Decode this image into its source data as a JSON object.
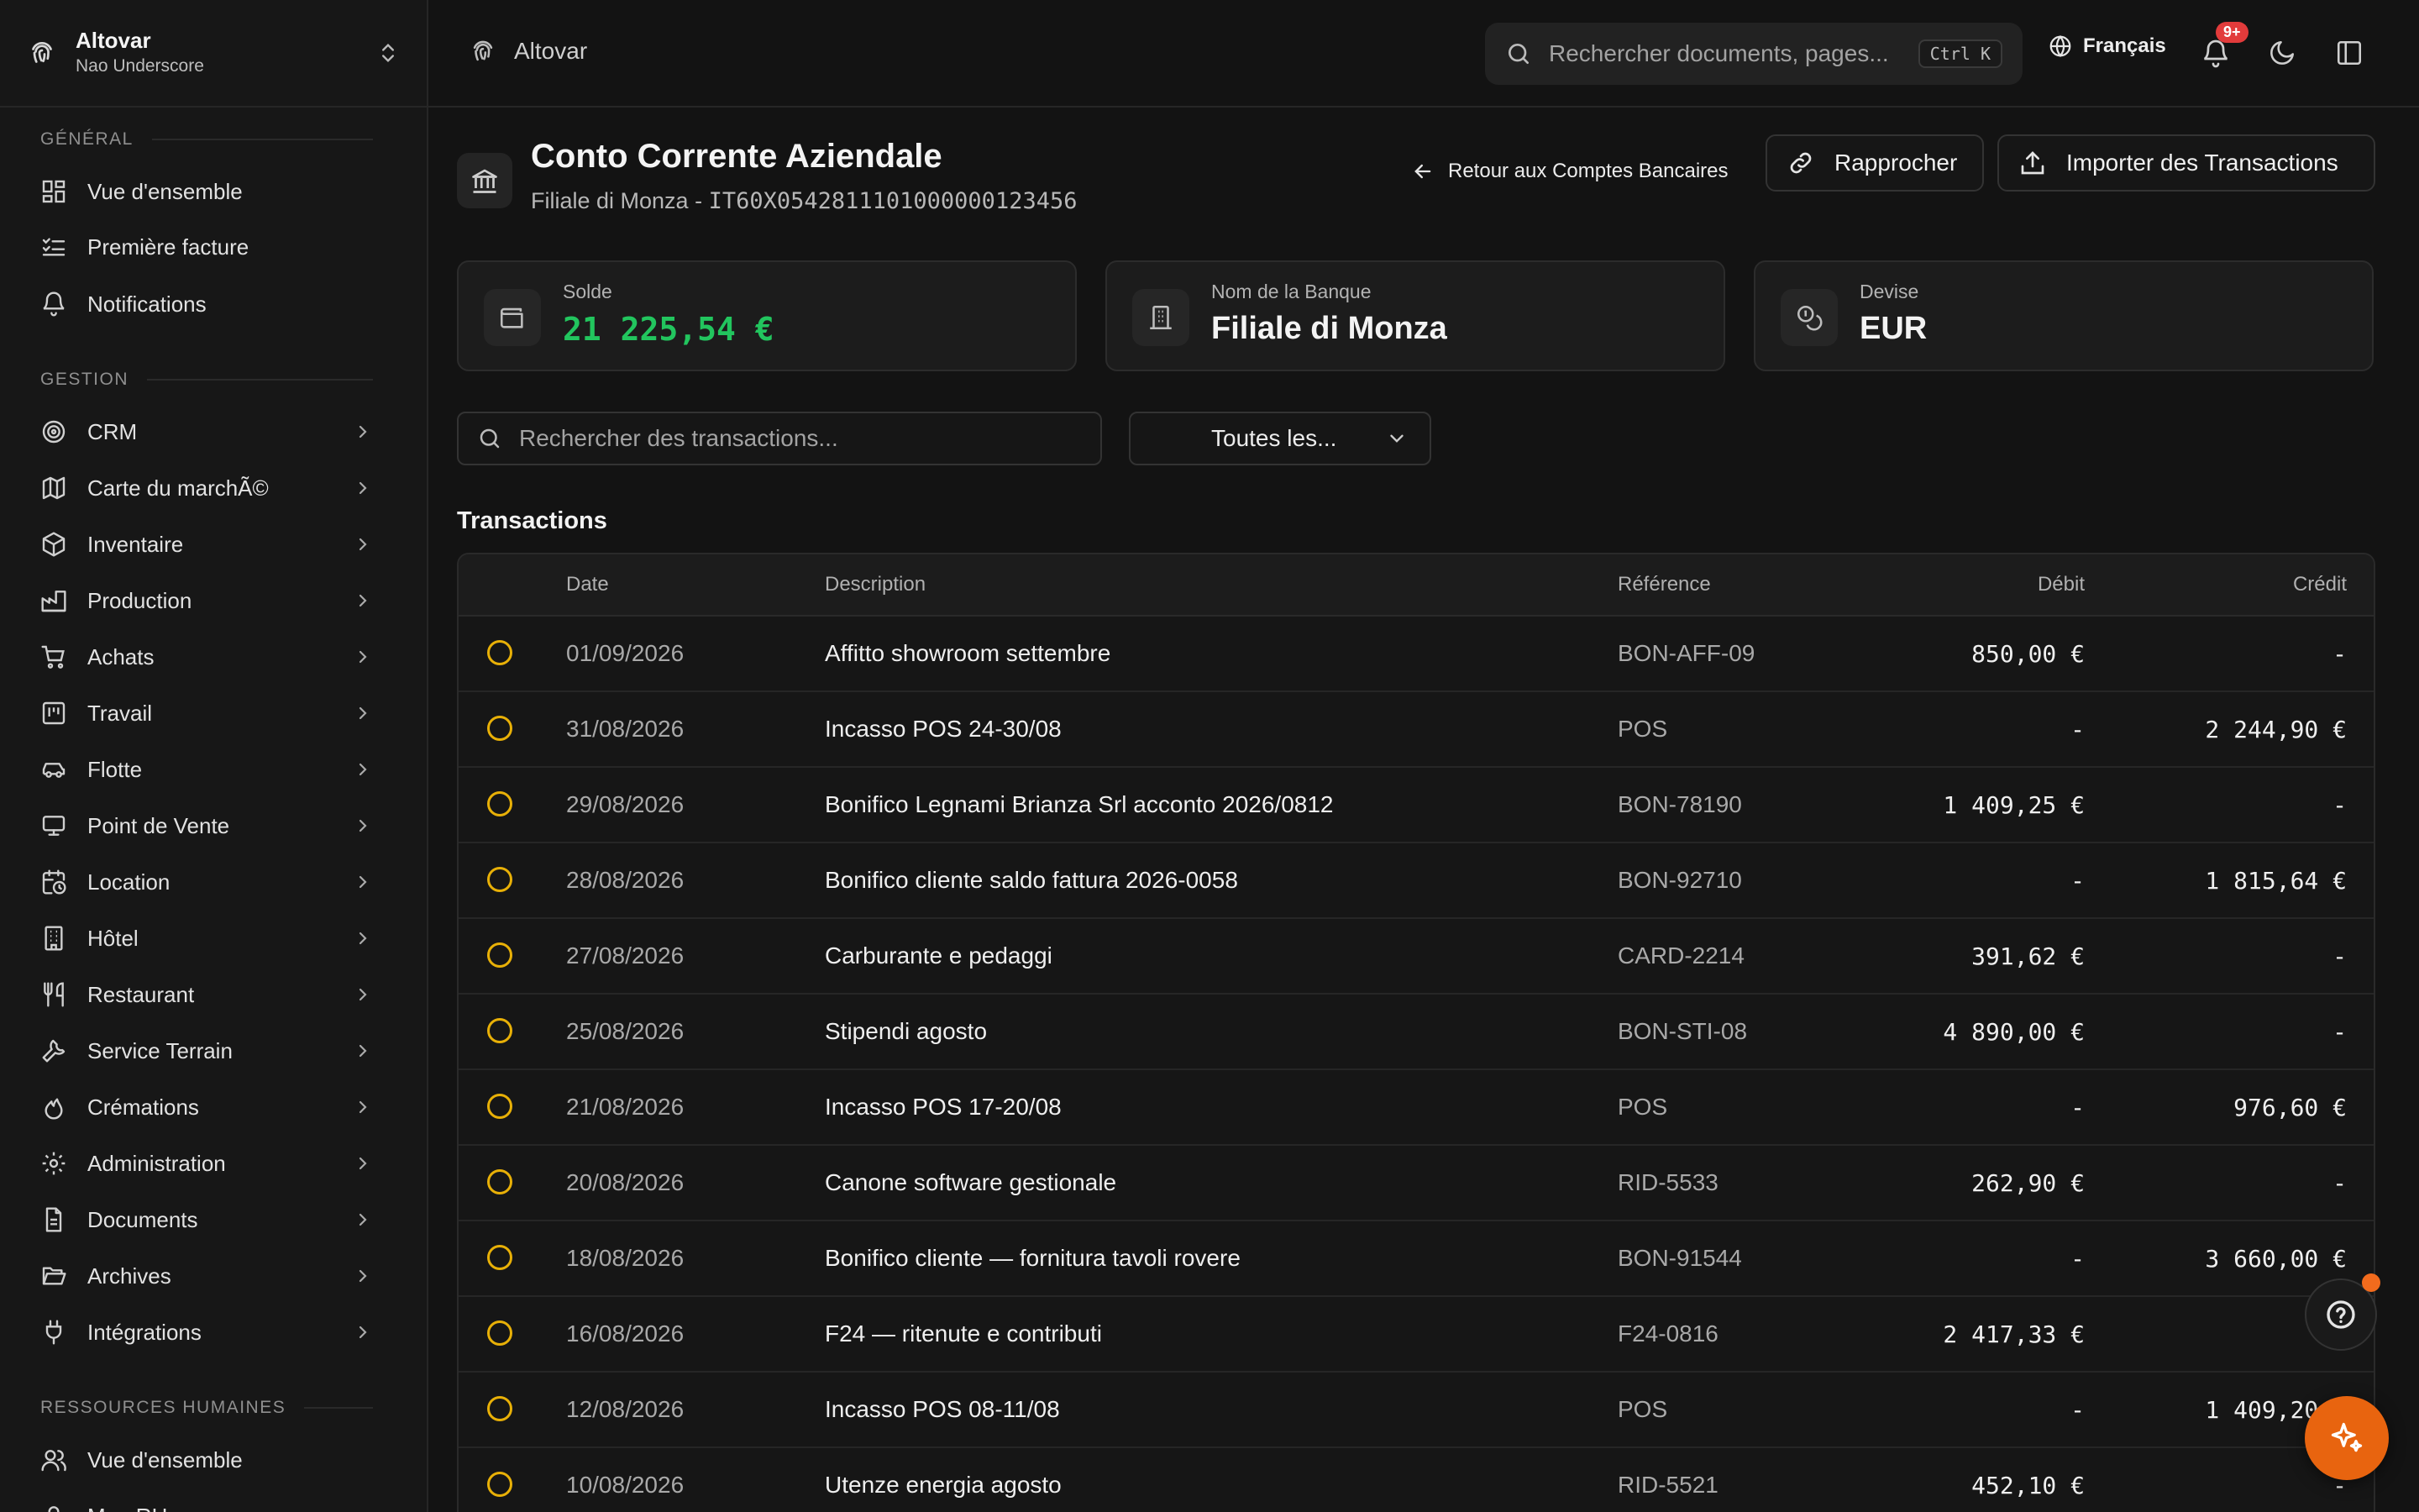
{
  "workspace": {
    "name": "Altovar",
    "user": "Nao Underscore"
  },
  "sidebar": {
    "sections": [
      {
        "title": "GÉNÉRAL"
      },
      {
        "title": "GESTION"
      },
      {
        "title": "RESSOURCES HUMAINES"
      }
    ],
    "general": [
      {
        "label": "Vue d'ensemble",
        "icon": "dashboard-icon"
      },
      {
        "label": "Première facture",
        "icon": "checklist-icon"
      },
      {
        "label": "Notifications",
        "icon": "bell-icon"
      }
    ],
    "gestion": [
      {
        "label": "CRM",
        "icon": "target-icon"
      },
      {
        "label": "Carte du marchÃ©",
        "icon": "map-icon"
      },
      {
        "label": "Inventaire",
        "icon": "box-icon"
      },
      {
        "label": "Production",
        "icon": "factory-icon"
      },
      {
        "label": "Achats",
        "icon": "cart-icon"
      },
      {
        "label": "Travail",
        "icon": "kanban-icon"
      },
      {
        "label": "Flotte",
        "icon": "car-icon"
      },
      {
        "label": "Point de Vente",
        "icon": "monitor-icon"
      },
      {
        "label": "Location",
        "icon": "calendar-clock-icon"
      },
      {
        "label": "Hôtel",
        "icon": "building-icon"
      },
      {
        "label": "Restaurant",
        "icon": "utensils-icon"
      },
      {
        "label": "Service Terrain",
        "icon": "wrench-icon"
      },
      {
        "label": "Crémations",
        "icon": "flame-icon"
      },
      {
        "label": "Administration",
        "icon": "gear-icon"
      },
      {
        "label": "Documents",
        "icon": "file-icon"
      },
      {
        "label": "Archives",
        "icon": "folder-open-icon"
      },
      {
        "label": "Intégrations",
        "icon": "plug-icon"
      }
    ],
    "hr": [
      {
        "label": "Vue d'ensemble",
        "icon": "users-icon"
      },
      {
        "label": "Mon RH",
        "icon": "user-icon"
      }
    ]
  },
  "topbar": {
    "breadcrumb": "Altovar",
    "search_placeholder": "Rechercher documents, pages...",
    "search_shortcut": "Ctrl K",
    "language": "Français",
    "notification_badge": "9+"
  },
  "account": {
    "title": "Conto Corrente Aziendale",
    "subtitle_branch": "Filiale di Monza - ",
    "subtitle_iban": "IT60X0542811101000000123456",
    "back_label": "Retour aux Comptes Bancaires",
    "reconcile_label": "Rapprocher",
    "import_label": "Importer des Transactions"
  },
  "cards": {
    "balance": {
      "label": "Solde",
      "value": "21 225,54 €",
      "color": "#22c55e"
    },
    "bank": {
      "label": "Nom de la Banque",
      "value": "Filiale di Monza"
    },
    "currency": {
      "label": "Devise",
      "value": "EUR"
    }
  },
  "filters": {
    "search_placeholder": "Rechercher des transactions...",
    "select_value": "Toutes les..."
  },
  "transactions": {
    "heading": "Transactions",
    "columns": {
      "date": "Date",
      "description": "Description",
      "reference": "Référence",
      "debit": "Débit",
      "credit": "Crédit"
    },
    "status_color": "#e8b007",
    "rows": [
      {
        "date": "01/09/2026",
        "description": "Affitto showroom settembre",
        "reference": "BON-AFF-09",
        "debit": "850,00 €",
        "credit": "-"
      },
      {
        "date": "31/08/2026",
        "description": "Incasso POS 24-30/08",
        "reference": "POS",
        "debit": "-",
        "credit": "2 244,90 €"
      },
      {
        "date": "29/08/2026",
        "description": "Bonifico Legnami Brianza Srl acconto 2026/0812",
        "reference": "BON-78190",
        "debit": "1 409,25 €",
        "credit": "-"
      },
      {
        "date": "28/08/2026",
        "description": "Bonifico cliente saldo fattura 2026-0058",
        "reference": "BON-92710",
        "debit": "-",
        "credit": "1 815,64 €"
      },
      {
        "date": "27/08/2026",
        "description": "Carburante e pedaggi",
        "reference": "CARD-2214",
        "debit": "391,62 €",
        "credit": "-"
      },
      {
        "date": "25/08/2026",
        "description": "Stipendi agosto",
        "reference": "BON-STI-08",
        "debit": "4 890,00 €",
        "credit": "-"
      },
      {
        "date": "21/08/2026",
        "description": "Incasso POS 17-20/08",
        "reference": "POS",
        "debit": "-",
        "credit": "976,60 €"
      },
      {
        "date": "20/08/2026",
        "description": "Canone software gestionale",
        "reference": "RID-5533",
        "debit": "262,90 €",
        "credit": "-"
      },
      {
        "date": "18/08/2026",
        "description": "Bonifico cliente — fornitura tavoli rovere",
        "reference": "BON-91544",
        "debit": "-",
        "credit": "3 660,00 €"
      },
      {
        "date": "16/08/2026",
        "description": "F24 — ritenute e contributi",
        "reference": "F24-0816",
        "debit": "2 417,33 €",
        "credit": "-"
      },
      {
        "date": "12/08/2026",
        "description": "Incasso POS 08-11/08",
        "reference": "POS",
        "debit": "-",
        "credit": "1 409,20 €"
      },
      {
        "date": "10/08/2026",
        "description": "Utenze energia agosto",
        "reference": "RID-5521",
        "debit": "452,10 €",
        "credit": "-"
      }
    ]
  },
  "floating": {
    "help": "help-circle-icon",
    "assistant": "sparkles-icon",
    "accent": "#e8640f"
  }
}
